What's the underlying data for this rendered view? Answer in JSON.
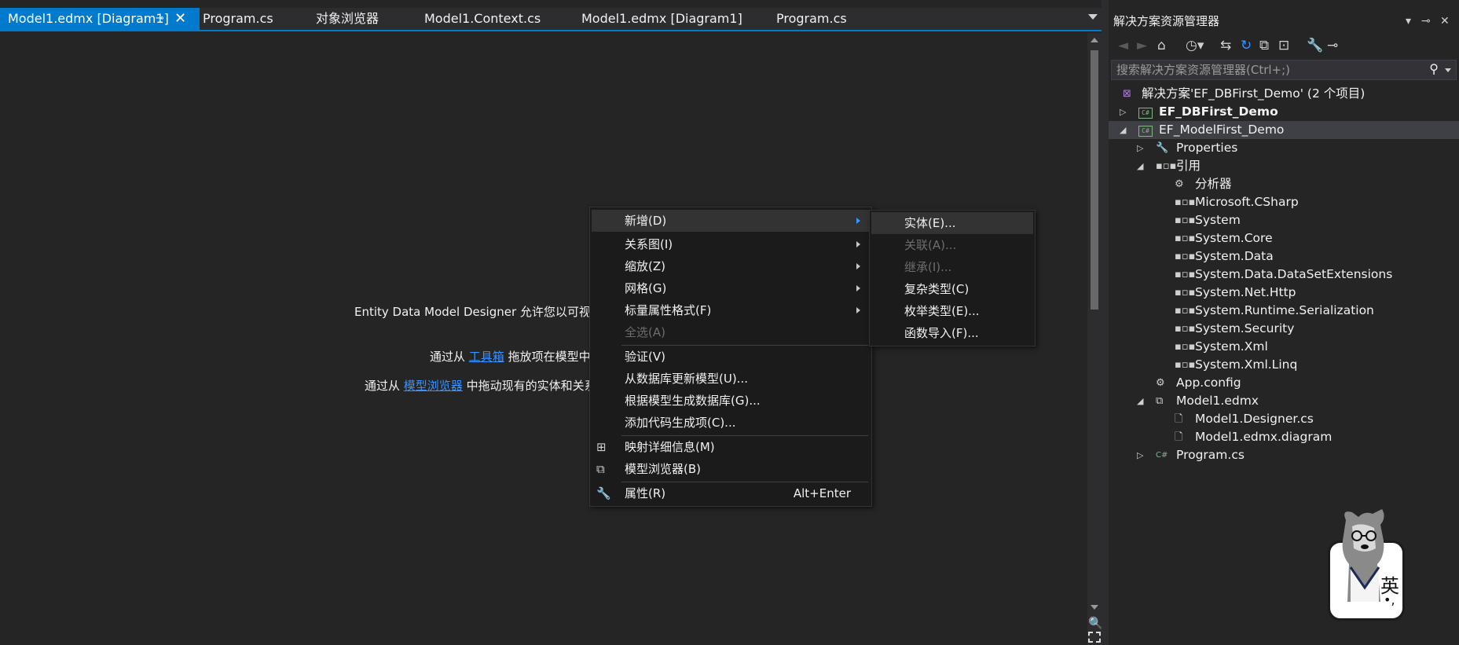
{
  "editor_tabs": [
    {
      "label": "Model1.edmx [Diagram1]",
      "active": true
    },
    {
      "label": "Program.cs"
    },
    {
      "label": "对象浏览器"
    },
    {
      "label": "Model1.Context.cs"
    },
    {
      "label": "Model1.edmx [Diagram1]"
    },
    {
      "label": "Program.cs"
    }
  ],
  "tab_icons": {
    "pin": "pin-icon",
    "close": "close-icon",
    "overflow": "chevron-down-icon"
  },
  "designer": {
    "line1": "Entity Data Model Designer 允许您以可视",
    "line2_prefix": "通过从",
    "line2_link": "工具箱",
    "line2_suffix": "拖放项在模型中",
    "line3_prefix": "通过从",
    "line3_link": "模型浏览器",
    "line3_suffix": "中拖动现有的实体和关系"
  },
  "context_menu": {
    "items": [
      {
        "label": "新增(D)",
        "submenu": true,
        "highlighted": true
      },
      {
        "label": "关系图(I)",
        "submenu": true
      },
      {
        "label": "缩放(Z)",
        "submenu": true
      },
      {
        "label": "网格(G)",
        "submenu": true
      },
      {
        "label": "标量属性格式(F)",
        "submenu": true
      },
      {
        "label": "全选(A)",
        "disabled": true
      },
      {
        "label": "验证(V)"
      },
      {
        "label": "从数据库更新模型(U)..."
      },
      {
        "label": "根据模型生成数据库(G)..."
      },
      {
        "label": "添加代码生成项(C)..."
      },
      {
        "label": "映射详细信息(M)",
        "icon": "mapping-details-icon"
      },
      {
        "label": "模型浏览器(B)",
        "icon": "model-browser-icon"
      },
      {
        "label": "属性(R)",
        "icon": "wrench-icon",
        "shortcut": "Alt+Enter"
      }
    ]
  },
  "submenu": {
    "items": [
      {
        "label": "实体(E)...",
        "highlighted": true
      },
      {
        "label": "关联(A)...",
        "disabled": true
      },
      {
        "label": "继承(I)...",
        "disabled": true
      },
      {
        "label": "复杂类型(C)"
      },
      {
        "label": "枚举类型(E)..."
      },
      {
        "label": "函数导入(F)..."
      }
    ]
  },
  "solution_explorer": {
    "title": "解决方案资源管理器",
    "search_placeholder": "搜索解决方案资源管理器(Ctrl+;)",
    "toolbar_icons": [
      "back-icon",
      "forward-icon",
      "home-icon",
      "history-icon",
      "sync-icon",
      "refresh-icon",
      "collapse-all-icon",
      "show-all-files-icon",
      "properties-wrench-icon",
      "preview-icon"
    ],
    "tree": [
      {
        "label": "解决方案'EF_DBFirst_Demo' (2 个项目)",
        "icon": "solution-icon"
      },
      {
        "label": "EF_DBFirst_Demo",
        "icon": "csharp-project-icon",
        "bold": true,
        "expander": "collapsed"
      },
      {
        "label": "EF_ModelFirst_Demo",
        "icon": "csharp-project-icon",
        "bold": false,
        "expander": "expanded",
        "selected": true
      },
      {
        "label": "Properties",
        "icon": "wrench-icon",
        "expander": "collapsed"
      },
      {
        "label": "引用",
        "icon": "references-icon",
        "expander": "expanded"
      },
      {
        "label": "分析器",
        "icon": "analyzer-icon"
      },
      {
        "label": "Microsoft.CSharp",
        "icon": "reference-icon"
      },
      {
        "label": "System",
        "icon": "reference-icon"
      },
      {
        "label": "System.Core",
        "icon": "reference-icon"
      },
      {
        "label": "System.Data",
        "icon": "reference-icon"
      },
      {
        "label": "System.Data.DataSetExtensions",
        "icon": "reference-icon"
      },
      {
        "label": "System.Net.Http",
        "icon": "reference-icon"
      },
      {
        "label": "System.Runtime.Serialization",
        "icon": "reference-icon"
      },
      {
        "label": "System.Security",
        "icon": "reference-icon"
      },
      {
        "label": "System.Xml",
        "icon": "reference-icon"
      },
      {
        "label": "System.Xml.Linq",
        "icon": "reference-icon"
      },
      {
        "label": "App.config",
        "icon": "config-file-icon"
      },
      {
        "label": "Model1.edmx",
        "icon": "edmx-file-icon",
        "expander": "expanded"
      },
      {
        "label": "Model1.Designer.cs",
        "icon": "code-file-icon"
      },
      {
        "label": "Model1.edmx.diagram",
        "icon": "code-file-icon"
      },
      {
        "label": "Program.cs",
        "icon": "csharp-file-icon",
        "expander": "collapsed"
      }
    ]
  },
  "ime_badge": {
    "char": "英",
    "punct": "•,"
  },
  "colors": {
    "accent": "#007acc",
    "link": "#3794ff",
    "background": "#252526",
    "menu_bg": "#1b1b1c"
  }
}
